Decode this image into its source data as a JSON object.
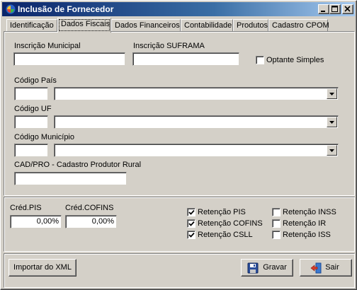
{
  "window": {
    "title": "Inclusão de Fornecedor"
  },
  "tabs": [
    {
      "label": "Identificação"
    },
    {
      "label": "Dados Fiscais"
    },
    {
      "label": "Dados Financeiros"
    },
    {
      "label": "Contabilidade"
    },
    {
      "label": "Produtos"
    },
    {
      "label": "Cadastro CPOM"
    }
  ],
  "fiscal": {
    "inscricao_municipal_label": "Inscrição Municipal",
    "inscricao_municipal_value": "",
    "inscricao_suframa_label": "Inscrição SUFRAMA",
    "inscricao_suframa_value": "",
    "optante_simples_label": "Optante Simples",
    "optante_simples_checked": false,
    "codigo_pais_label": "Código País",
    "codigo_pais_value": "",
    "pais_selected": "",
    "codigo_uf_label": "Código UF",
    "codigo_uf_value": "",
    "uf_selected": "",
    "codigo_municipio_label": "Código Município",
    "codigo_municipio_value": "",
    "municipio_selected": "",
    "cad_pro_label": "CAD/PRO - Cadastro Produtor Rural",
    "cad_pro_value": ""
  },
  "credits": {
    "cred_pis_label": "Créd.PIS",
    "cred_pis_value": "0,00%",
    "cred_cofins_label": "Créd.COFINS",
    "cred_cofins_value": "0,00%"
  },
  "retencoes": {
    "pis": {
      "label": "Retenção PIS",
      "checked": true
    },
    "cofins": {
      "label": "Retenção COFINS",
      "checked": true
    },
    "csll": {
      "label": "Retenção CSLL",
      "checked": true
    },
    "inss": {
      "label": "Retenção INSS",
      "checked": false
    },
    "ir": {
      "label": "Retenção IR",
      "checked": false
    },
    "iss": {
      "label": "Retenção ISS",
      "checked": false
    }
  },
  "buttons": {
    "importar_xml": "Importar do XML",
    "gravar": "Gravar",
    "sair": "Sair"
  },
  "colors": {
    "titlebar_start": "#0a246a",
    "titlebar_end": "#a6caf0",
    "face": "#d4d0c8"
  }
}
